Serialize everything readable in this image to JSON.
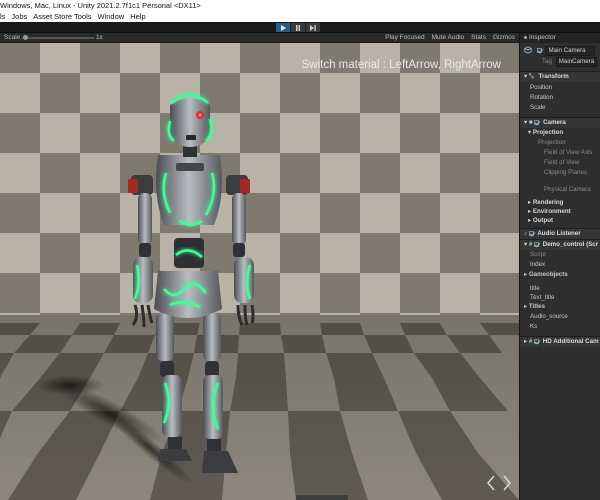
{
  "window": {
    "title": "Windows, Mac, Linux - Unity 2021.2.7f1c1 Personal <DX11>"
  },
  "menu": {
    "items": [
      "ls",
      "Jobs",
      "Asset Store Tools",
      "Window",
      "Help"
    ]
  },
  "game_toolbar": {
    "scale_label": "Scale",
    "scale_value": "1x",
    "scale_slider_level": 0.0,
    "play_focused": "Play Focused",
    "mute_audio": "Mute Audio",
    "stats": "Stats",
    "gizmos": "Gizmos"
  },
  "viewport": {
    "hint": "Switch material : LeftArrow, RightArrow"
  },
  "inspector": {
    "tab_label": "Inspector",
    "object_name": "Main Camera",
    "tag_label": "Tag",
    "tag_value": "MainCamera",
    "transform": {
      "header": "Transform",
      "fields": [
        "Position",
        "Rotation",
        "Scale"
      ]
    },
    "camera": {
      "header": "Camera",
      "projection_group": "Projection",
      "projection_label": "Projection",
      "fov_axis": "Field of View Axis",
      "fov": "Field of View",
      "clipping": "Clipping Planes",
      "physical": "Physical Camera",
      "rendering": "Rendering",
      "environment": "Environment",
      "output": "Output"
    },
    "audio_listener": "Audio Listener",
    "demo_control": {
      "header": "Demo_control (Scr",
      "script": "Script",
      "index": "Index",
      "gameobjects": "Gameobjects",
      "title": "title",
      "text_title": "Text_title",
      "titles": "Titles",
      "audio_source": "Audio_source",
      "ks": "Ks"
    },
    "hd_camera": "HD Additional Cam"
  },
  "colors": {
    "accent_blue": "#2c5d87",
    "glow_green": "#3dff9a",
    "eye_red": "#d23a2a"
  }
}
